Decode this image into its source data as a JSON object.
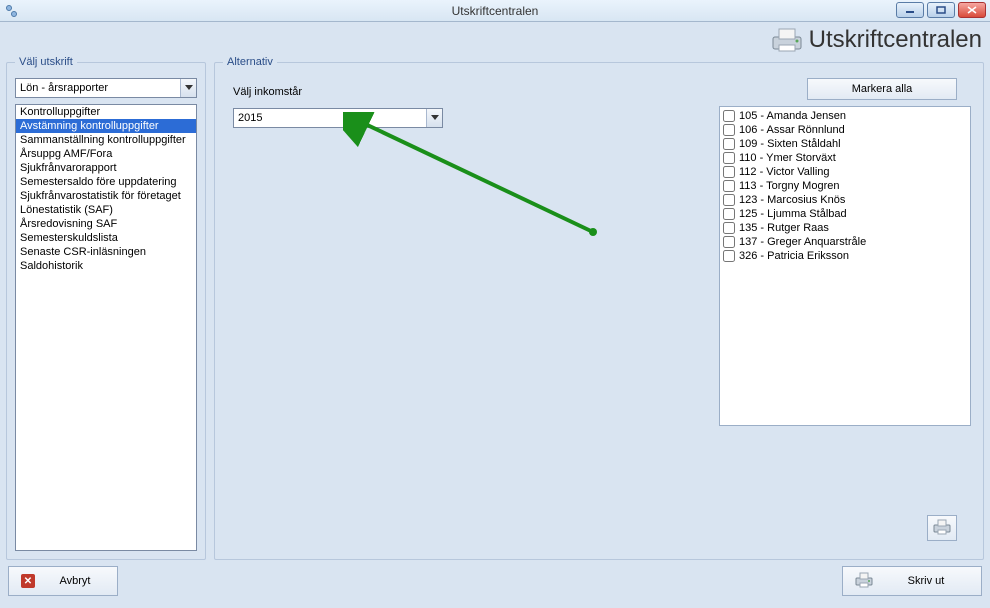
{
  "window": {
    "title": "Utskriftcentralen"
  },
  "header": {
    "big_title": "Utskriftcentralen"
  },
  "left": {
    "legend": "Välj utskrift",
    "combo_value": "Lön - årsrapporter",
    "items": [
      "Kontrolluppgifter",
      "Avstämning kontrolluppgifter",
      "Sammanställning kontrolluppgifter",
      "Årsuppg AMF/Fora",
      "Sjukfrånvarorapport",
      "Semestersaldo före uppdatering",
      "Sjukfrånvarostatistik för företaget",
      "Lönestatistik (SAF)",
      "Årsredovisning SAF",
      "Semesterskuldslista",
      "Senaste CSR-inläsningen",
      "Saldohistorik"
    ],
    "selected_index": 1
  },
  "right": {
    "legend": "Alternativ",
    "income_label": "Välj inkomstår",
    "income_value": "2015",
    "mark_all_label": "Markera alla",
    "people": [
      "105 - Amanda Jensen",
      "106 - Assar Rönnlund",
      "109 - Sixten Ståldahl",
      "110 - Ymer Storväxt",
      "112 - Victor Valling",
      "113 - Torgny Mogren",
      "123 - Marcosius Knös",
      "125 - Ljumma Stålbad",
      "135 - Rutger Raas",
      "137 - Greger Anquarstråle",
      "326 - Patricia Eriksson"
    ]
  },
  "buttons": {
    "cancel": "Avbryt",
    "print": "Skriv ut"
  }
}
